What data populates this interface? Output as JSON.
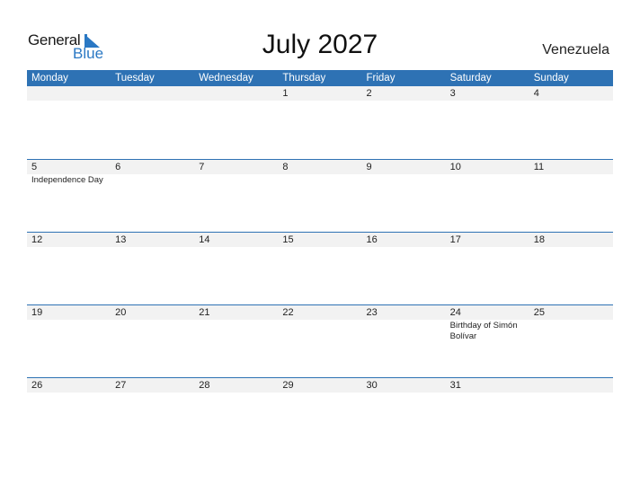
{
  "logo": {
    "line1": "General",
    "line2": "Blue"
  },
  "title": "July 2027",
  "country": "Venezuela",
  "colors": {
    "header_bg": "#2e72b4",
    "accent": "#2a78c4",
    "day_row_bg": "#f2f2f2"
  },
  "weekdays": [
    "Monday",
    "Tuesday",
    "Wednesday",
    "Thursday",
    "Friday",
    "Saturday",
    "Sunday"
  ],
  "weeks": [
    {
      "days": [
        "",
        "",
        "",
        "1",
        "2",
        "3",
        "4"
      ],
      "events": [
        "",
        "",
        "",
        "",
        "",
        "",
        ""
      ]
    },
    {
      "days": [
        "5",
        "6",
        "7",
        "8",
        "9",
        "10",
        "11"
      ],
      "events": [
        "Independence Day",
        "",
        "",
        "",
        "",
        "",
        ""
      ]
    },
    {
      "days": [
        "12",
        "13",
        "14",
        "15",
        "16",
        "17",
        "18"
      ],
      "events": [
        "",
        "",
        "",
        "",
        "",
        "",
        ""
      ]
    },
    {
      "days": [
        "19",
        "20",
        "21",
        "22",
        "23",
        "24",
        "25"
      ],
      "events": [
        "",
        "",
        "",
        "",
        "",
        "Birthday of Simón Bolívar",
        ""
      ]
    },
    {
      "days": [
        "26",
        "27",
        "28",
        "29",
        "30",
        "31",
        ""
      ],
      "events": [
        "",
        "",
        "",
        "",
        "",
        "",
        ""
      ]
    }
  ]
}
